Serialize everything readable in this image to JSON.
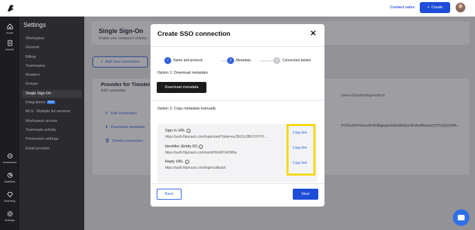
{
  "header": {
    "contact_sales": "Contact sales",
    "create_label": "Create"
  },
  "rail": {
    "items": [
      {
        "label": "Home",
        "icon": "home-icon"
      },
      {
        "label": "Assets",
        "icon": "file-icon"
      },
      {
        "label": "Automation",
        "icon": "automation-icon"
      },
      {
        "label": "Statistics",
        "icon": "stats-icon"
      },
      {
        "label": "Branding",
        "icon": "diamond-icon"
      },
      {
        "label": "Settings",
        "icon": "gear-icon"
      }
    ]
  },
  "settings": {
    "title": "Settings",
    "items": [
      {
        "label": "Workspace"
      },
      {
        "label": "General"
      },
      {
        "label": "Billing"
      },
      {
        "label": "Teammates"
      },
      {
        "label": "Readers"
      },
      {
        "label": "Groups"
      },
      {
        "label": "Single Sign-On"
      },
      {
        "label": "Integrations",
        "badge": "NEW"
      },
      {
        "label": "MLS - Multiple list services"
      },
      {
        "label": "Workspace access"
      },
      {
        "label": "Teammate activity"
      },
      {
        "label": "Permission settings"
      },
      {
        "label": "Email provider"
      }
    ]
  },
  "background": {
    "title": "Single Sign-On",
    "subtitle": "Enable your company's employ",
    "add_connection": "Add new connection",
    "provider_title": "Provider for Timotei Pr",
    "provider_sub": "SSO connection",
    "edit": "Edit connection",
    "download": "Download metadata",
    "delete": "Delete connection",
    "url_fragment": "saml-v2/sso/binding/redirect/",
    "cert_fragment": "POOkcW5YkOne0bTANBgkqhkiG9w0BAQsFADAxMRswGQYDVQQDDBN..."
  },
  "modal": {
    "title": "Create SSO connection",
    "steps": [
      {
        "label": "Name and protocol",
        "state": "done",
        "marker": "✓"
      },
      {
        "label": "Metadata",
        "state": "current",
        "marker": "2"
      },
      {
        "label": "Connection details",
        "state": "todo",
        "marker": "3"
      }
    ],
    "option1": "Option 1: Download metadata",
    "download_btn": "Download metadata",
    "option2": "Option 2: Copy metadata manually",
    "fields": [
      {
        "label": "Sign in URL",
        "value": "https://auth.flipsnack.com/login/saml?data=eyJ3b2Jc3BhY2VIYX..."
      },
      {
        "label": "Identifier (Entity ID)",
        "value": "https://auth.flipsnack.com/saml/HdxWCAXWba"
      },
      {
        "label": "Reply URL",
        "value": "https://auth.flipsnack.com/login/callback"
      }
    ],
    "copy_link": "Copy link",
    "back": "Back",
    "next": "Next"
  },
  "colors": {
    "accent": "#1e4ed8",
    "highlight": "#f5d90a",
    "sidebar_bg": "#2b2b2f",
    "rail_bg": "#1d1d20"
  }
}
